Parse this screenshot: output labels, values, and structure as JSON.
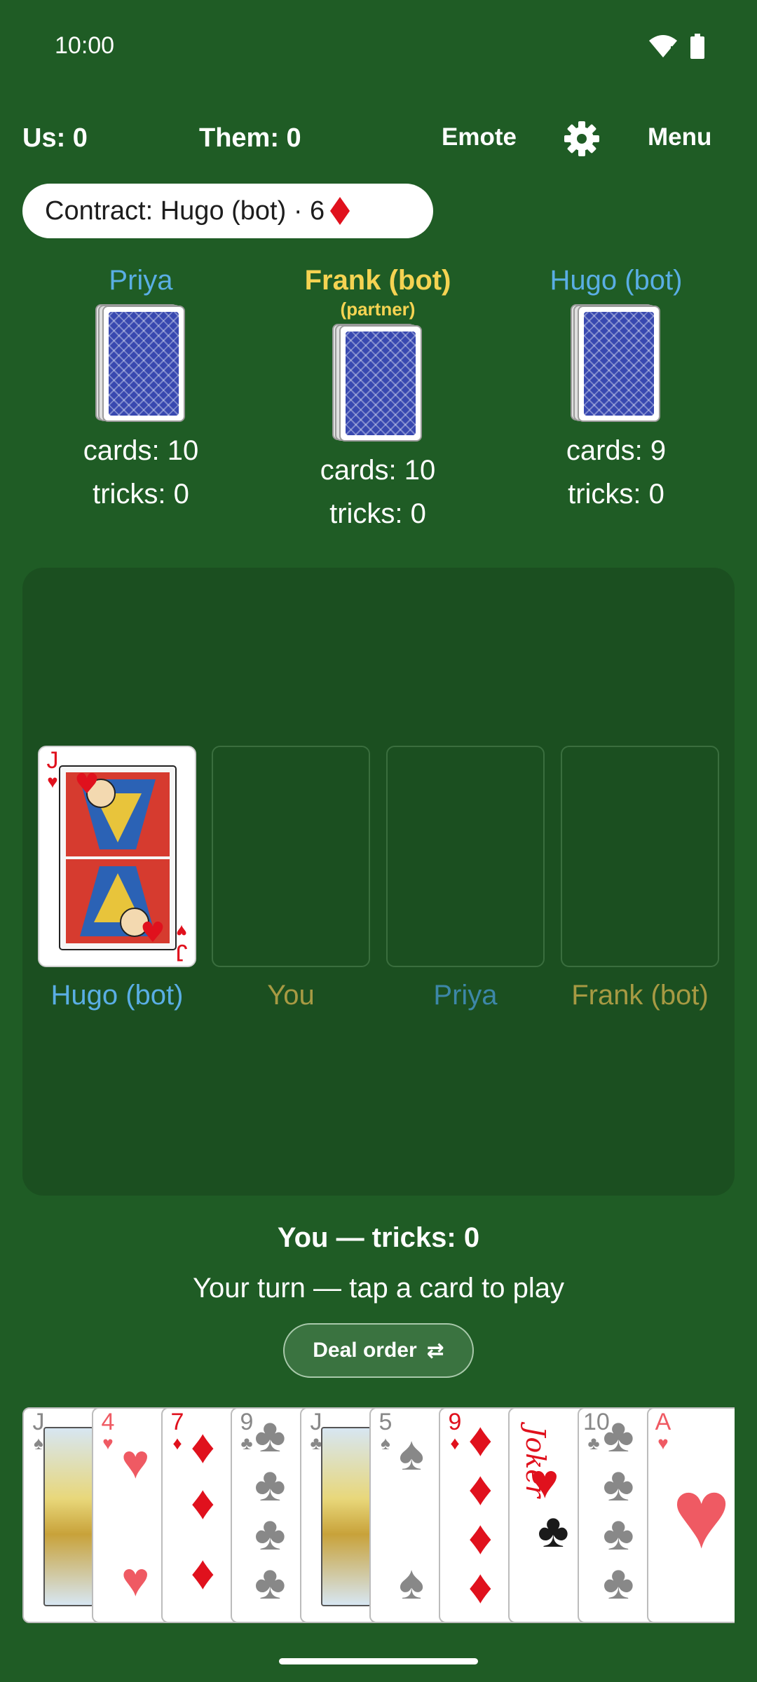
{
  "status": {
    "time": "10:00"
  },
  "topbar": {
    "us": "Us: 0",
    "them": "Them: 0",
    "emote": "Emote",
    "menu": "Menu"
  },
  "contract": {
    "text": "Contract: Hugo (bot) · 6"
  },
  "players": [
    {
      "name": "Priya",
      "cards": "cards: 10",
      "tricks": "tricks: 0",
      "partner": false
    },
    {
      "name": "Frank (bot)",
      "tag": "(partner)",
      "cards": "cards: 10",
      "tricks": "tricks: 0",
      "partner": true
    },
    {
      "name": "Hugo (bot)",
      "cards": "cards: 9",
      "tricks": "tricks: 0",
      "partner": false
    }
  ],
  "trick": {
    "played_card": {
      "rank": "J",
      "suit": "hearts"
    },
    "labels": [
      "Hugo (bot)",
      "You",
      "Priya",
      "Frank (bot)"
    ]
  },
  "info": {
    "you_tricks": "You — tricks: 0",
    "turn": "Your turn — tap a card to play",
    "deal_order": "Deal order",
    "deal_order_icon": "⇄"
  },
  "hand": [
    {
      "rank": "J",
      "suit": "♠"
    },
    {
      "rank": "4",
      "suit": "♥"
    },
    {
      "rank": "7",
      "suit": "♦"
    },
    {
      "rank": "9",
      "suit": "♣"
    },
    {
      "rank": "J",
      "suit": "♣"
    },
    {
      "rank": "5",
      "suit": "♠"
    },
    {
      "rank": "9",
      "suit": "♦"
    },
    {
      "rank": "Joker",
      "suit": ""
    },
    {
      "rank": "10",
      "suit": "♣"
    },
    {
      "rank": "A",
      "suit": "♥"
    }
  ],
  "colors": {
    "background": "#1f5c25",
    "table": "#1b4f20",
    "opponent": "#5aaee4",
    "partner": "#f5d352",
    "red_suit": "#e0111d"
  }
}
